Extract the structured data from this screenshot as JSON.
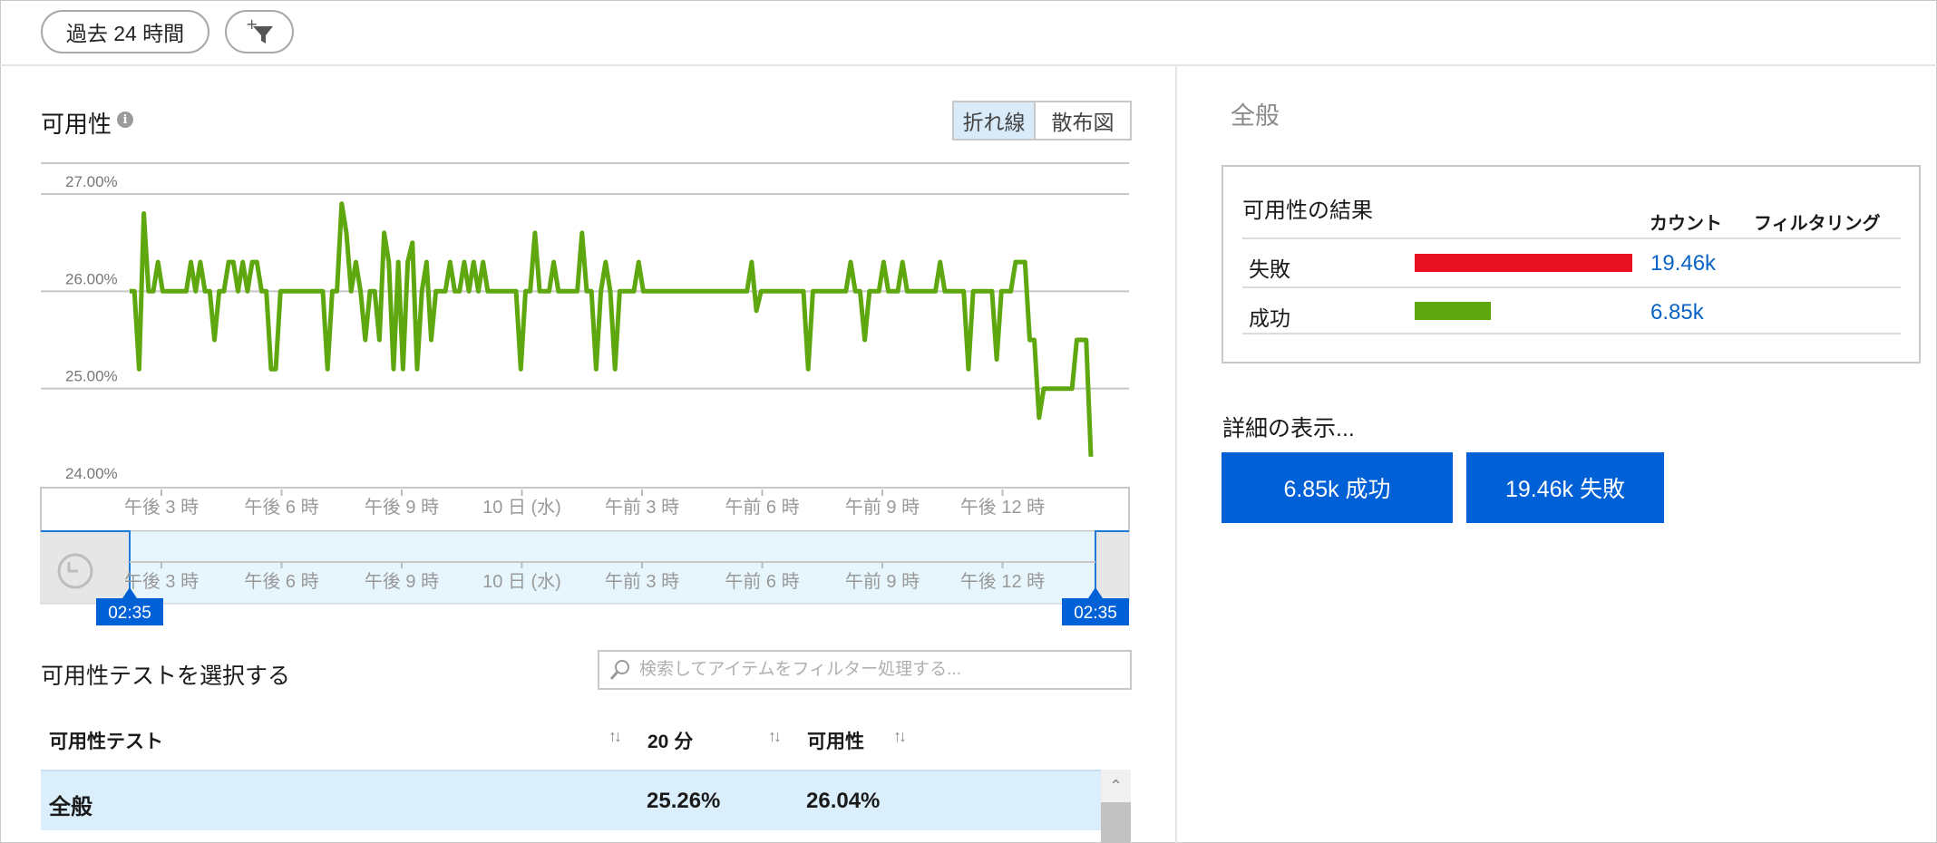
{
  "toolbar": {
    "time_range_label": "過去 24 時間",
    "add_filter_icon": "add-filter-icon"
  },
  "availability": {
    "title": "可用性",
    "info_icon_glyph": "i",
    "view_toggle": {
      "line": "折れ線",
      "scatter": "散布図",
      "selected": "折れ線"
    }
  },
  "chart_data": {
    "type": "line",
    "title": "",
    "y_tick_labels": [
      "27.00%",
      "26.00%",
      "25.00%",
      "24.00%"
    ],
    "ylim": [
      24.0,
      27.0
    ],
    "x_tick_labels": [
      "午後 3 時",
      "午後 6 時",
      "午後 9 時",
      "10 日 (水)",
      "午前 3 時",
      "午前 6 時",
      "午前 9 時",
      "午後 12 時"
    ],
    "grid": true,
    "color": "#5ea70e",
    "series": [
      {
        "values": [
          26.0,
          26.0,
          25.2,
          26.8,
          26.0,
          26.0,
          26.3,
          26.0,
          26.0,
          26.0,
          26.0,
          26.0,
          26.0,
          26.3,
          26.0,
          26.3,
          26.0,
          26.0,
          25.5,
          26.0,
          26.0,
          26.3,
          26.3,
          26.0,
          26.3,
          26.0,
          26.3,
          26.3,
          26.0,
          26.0,
          25.2,
          25.2,
          26.0,
          26.0,
          26.0,
          26.0,
          26.0,
          26.0,
          26.0,
          26.0,
          26.0,
          26.0,
          25.2,
          26.0,
          26.0,
          26.9,
          26.6,
          26.0,
          26.3,
          26.0,
          25.5,
          26.0,
          26.0,
          25.5,
          26.6,
          26.3,
          25.2,
          26.3,
          25.2,
          26.3,
          26.5,
          25.2,
          26.0,
          26.3,
          25.5,
          26.0,
          26.0,
          26.0,
          26.3,
          26.0,
          26.0,
          26.3,
          26.0,
          26.3,
          26.0,
          26.3,
          26.0,
          26.0,
          26.0,
          26.0,
          26.0,
          26.0,
          26.0,
          25.2,
          26.0,
          26.0,
          26.6,
          26.0,
          26.0,
          26.0,
          26.3,
          26.0,
          26.0,
          26.0,
          26.0,
          26.0,
          26.6,
          26.0,
          26.0,
          25.2,
          26.0,
          26.3,
          26.0,
          25.2,
          26.0,
          26.0,
          26.0,
          26.0,
          26.3,
          26.0,
          26.0,
          26.0,
          26.0,
          26.0,
          26.0,
          26.0,
          26.0,
          26.0,
          26.0,
          26.0,
          26.0,
          26.0,
          26.0,
          26.0,
          26.0,
          26.0,
          26.0,
          26.0,
          26.0,
          26.0,
          26.0,
          26.0,
          26.3,
          25.8,
          26.0,
          26.0,
          26.0,
          26.0,
          26.0,
          26.0,
          26.0,
          26.0,
          26.0,
          26.0,
          25.2,
          26.0,
          26.0,
          26.0,
          26.0,
          26.0,
          26.0,
          26.0,
          26.0,
          26.3,
          26.0,
          26.0,
          25.5,
          26.0,
          26.0,
          26.0,
          26.3,
          26.0,
          26.0,
          26.0,
          26.3,
          26.0,
          26.0,
          26.0,
          26.0,
          26.0,
          26.0,
          26.0,
          26.3,
          26.0,
          26.0,
          26.0,
          26.0,
          26.0,
          25.2,
          26.0,
          26.0,
          26.0,
          26.0,
          26.0,
          25.3,
          26.0,
          26.0,
          26.0,
          26.3,
          26.3,
          26.3,
          25.5,
          25.5,
          24.7,
          25.0,
          25.0,
          25.0,
          25.0,
          25.0,
          25.0,
          25.0,
          25.5,
          25.5,
          25.5,
          24.3
        ]
      }
    ]
  },
  "time_brush": {
    "tick_labels": [
      "午後 3 時",
      "午後 6 時",
      "午後 9 時",
      "10 日 (水)",
      "午前 3 時",
      "午前 6 時",
      "午前 9 時",
      "午後 12 時"
    ],
    "start_label": "02:35",
    "end_label": "02:35",
    "reset_icon": "undo-icon"
  },
  "tests": {
    "title": "可用性テストを選択する",
    "search_placeholder": "検索してアイテムをフィルター処理する...",
    "columns": [
      "可用性テスト",
      "20 分",
      "可用性"
    ],
    "sort_glyph": "↑↓",
    "rows": [
      {
        "name": "全般",
        "twenty_min": "25.26%",
        "availability": "26.04%"
      }
    ]
  },
  "overview": {
    "title": "全般",
    "results_title": "可用性の結果",
    "columns": {
      "count": "カウント",
      "filtering": "フィルタリング"
    },
    "rows": [
      {
        "label": "失敗",
        "count": "19.46k",
        "value": 19460,
        "color": "#e81123"
      },
      {
        "label": "成功",
        "count": "6.85k",
        "value": 6850,
        "color": "#5ea70e"
      }
    ],
    "details_label": "詳細の表示...",
    "buttons": {
      "success": "6.85k 成功",
      "failure": "19.46k 失敗"
    }
  }
}
